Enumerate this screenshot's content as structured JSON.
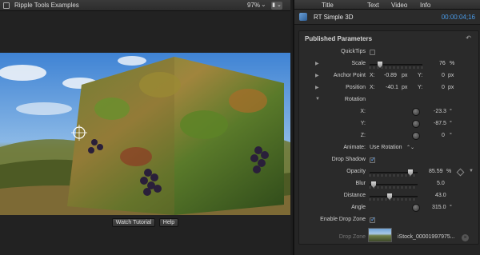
{
  "viewer": {
    "title": "Ripple Tools Examples",
    "zoom": "97%",
    "zoom_chevron": "⌄",
    "view_button": "▮ ⌄",
    "buttons": {
      "watch_tutorial": "Watch Tutorial",
      "help": "Help"
    }
  },
  "inspector": {
    "tabs": [
      "Title",
      "Text",
      "Video",
      "Info"
    ],
    "generator_name": "RT Simple 3D",
    "timecode": "00:00:04;16",
    "section_title": "Published Parameters",
    "reset_glyph": "↶",
    "params": {
      "quicktips": {
        "label": "QuickTips"
      },
      "scale": {
        "label": "Scale",
        "value": "76",
        "unit": "%"
      },
      "anchor_point": {
        "label": "Anchor Point",
        "x_label": "X:",
        "x_value": "-0.89",
        "x_unit": "px",
        "y_label": "Y:",
        "y_value": "0",
        "y_unit": "px"
      },
      "position": {
        "label": "Position",
        "x_label": "X:",
        "x_value": "-40.1",
        "x_unit": "px",
        "y_label": "Y:",
        "y_value": "0",
        "y_unit": "px"
      },
      "rotation": {
        "label": "Rotation"
      },
      "rot_x": {
        "label": "X:",
        "value": "-23.3",
        "unit": "°"
      },
      "rot_y": {
        "label": "Y:",
        "value": "-87.5",
        "unit": "°"
      },
      "rot_z": {
        "label": "Z:",
        "value": "0",
        "unit": "°"
      },
      "animate": {
        "label": "Animate:",
        "value": "Use Rotation",
        "chevron": "⌃⌄"
      },
      "drop_shadow": {
        "label": "Drop Shadow",
        "checked": true
      },
      "opacity": {
        "label": "Opacity",
        "value": "85.59",
        "unit": "%",
        "level_percent": 85.59
      },
      "blur": {
        "label": "Blur",
        "value": "5.0"
      },
      "distance": {
        "label": "Distance",
        "value": "43.0"
      },
      "angle": {
        "label": "Angle",
        "value": "315.0",
        "unit": "°"
      },
      "enable_drop_zone": {
        "label": "Enable Drop Zone",
        "checked": true
      },
      "drop_zone": {
        "label": "Drop Zone",
        "file": "iStock_00001997975..."
      }
    }
  },
  "colors": {
    "accent": "#4a9be8",
    "panel": "#2a2a2a"
  }
}
